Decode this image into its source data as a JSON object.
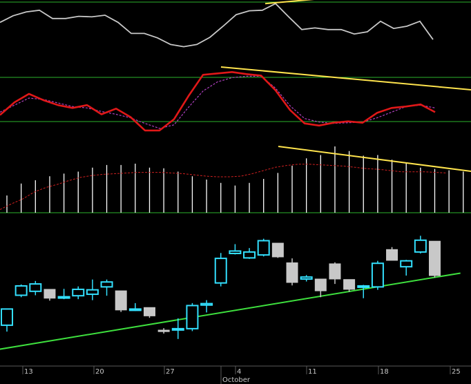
{
  "colors": {
    "background": "#000000",
    "grid": "#2bb52b",
    "trendline": "#ffe44d",
    "support_line": "#3ee03e",
    "oscillator_line": "#c8c8c8",
    "stoch_k": "#e01818",
    "stoch_d": "#b040c0",
    "volume_bar": "#ffffff",
    "volume_ma": "#d02020",
    "candle_up": "#33e0ff",
    "candle_down": "#c8c8c8",
    "axis_text": "#c8c8c8"
  },
  "chart_data": [
    {
      "type": "line",
      "panel": "oscillator",
      "x": [
        0,
        1,
        2,
        3,
        4,
        5,
        6,
        7,
        8,
        9,
        10,
        11,
        12,
        13,
        14,
        15,
        16,
        17,
        18,
        19,
        20,
        21,
        22,
        23,
        24,
        25,
        26,
        27,
        28,
        29,
        30
      ],
      "series": [
        {
          "values": [
            62,
            74,
            81,
            84,
            69,
            69,
            73,
            72,
            75,
            62,
            42,
            42,
            34,
            22,
            18,
            22,
            35,
            55,
            76,
            83,
            84,
            96,
            72,
            49,
            52,
            49,
            49,
            41,
            45,
            64,
            51,
            55,
            64,
            31
          ]
        }
      ],
      "ylim": [
        0,
        100
      ],
      "trendlines": [
        {
          "x": [
            18,
            31.4
          ],
          "y": [
            96,
            64
          ]
        }
      ]
    },
    {
      "type": "line",
      "panel": "stochastic",
      "series": [
        {
          "values": [
            26,
            44,
            56,
            47,
            40,
            36,
            40,
            27,
            35,
            23,
            4,
            4,
            20,
            53,
            83,
            85,
            87,
            84,
            82,
            61,
            33,
            14,
            11,
            15,
            17,
            15,
            29,
            36,
            38,
            41,
            30
          ]
        },
        {
          "values": [
            30,
            40,
            50,
            48,
            43,
            38,
            36,
            31,
            27,
            22,
            14,
            7,
            12,
            37,
            60,
            73,
            79,
            81,
            81,
            64,
            39,
            21,
            16,
            14,
            15,
            16,
            22,
            30,
            38,
            40,
            36
          ]
        }
      ],
      "ylim": [
        0,
        100
      ],
      "levels": [
        80,
        20
      ],
      "trendlines": [
        {
          "x": [
            15,
            32
          ],
          "y": [
            85,
            38
          ]
        }
      ]
    },
    {
      "type": "bar",
      "panel": "volume",
      "values": [
        26,
        44,
        49,
        55,
        59,
        62,
        68,
        72,
        72,
        74,
        68,
        67,
        62,
        55,
        50,
        45,
        41,
        45,
        51,
        60,
        71,
        82,
        87,
        100,
        93,
        86,
        87,
        80,
        75,
        68,
        66,
        64,
        62,
        66,
        57,
        60,
        64,
        70,
        64
      ],
      "moving_average": [
        5,
        14,
        22,
        33,
        40,
        45,
        51,
        56,
        59,
        61,
        62,
        63,
        64,
        64,
        64,
        63,
        62,
        60,
        58,
        57,
        57,
        58,
        62,
        67,
        72,
        75,
        77,
        77,
        76,
        75,
        74,
        72,
        70,
        69,
        67,
        65,
        65,
        65,
        64,
        63
      ],
      "ylim": [
        0,
        100
      ],
      "trendlines": [
        {
          "x": [
            0,
            13.4
          ],
          "y": [
            100,
            65
          ]
        }
      ]
    },
    {
      "type": "candlestick",
      "panel": "price",
      "x_ticks": [
        "13",
        "20",
        "27",
        "4",
        "11",
        "18",
        "25"
      ],
      "x_month_label": "October",
      "candles": [
        {
          "o": 36.2,
          "h": 39.6,
          "l": 34.9,
          "c": 39.5,
          "dir": "up"
        },
        {
          "o": 42.3,
          "h": 44.5,
          "l": 41.9,
          "c": 44.2,
          "dir": "up"
        },
        {
          "o": 43.1,
          "h": 45.2,
          "l": 42.3,
          "c": 44.6,
          "dir": "up"
        },
        {
          "o": 43.5,
          "h": 43.5,
          "l": 41.2,
          "c": 41.7,
          "dir": "down"
        },
        {
          "o": 42.0,
          "h": 43.6,
          "l": 41.5,
          "c": 42.0,
          "dir": "up"
        },
        {
          "o": 42.2,
          "h": 44.1,
          "l": 41.5,
          "c": 43.5,
          "dir": "up"
        },
        {
          "o": 42.5,
          "h": 45.5,
          "l": 41.3,
          "c": 43.4,
          "dir": "up"
        },
        {
          "o": 44.0,
          "h": 45.5,
          "l": 42.2,
          "c": 45.0,
          "dir": "up"
        },
        {
          "o": 43.2,
          "h": 43.2,
          "l": 38.9,
          "c": 39.3,
          "dir": "down"
        },
        {
          "o": 39.5,
          "h": 40.7,
          "l": 39.1,
          "c": 39.5,
          "dir": "up"
        },
        {
          "o": 39.8,
          "h": 39.8,
          "l": 37.7,
          "c": 38.1,
          "dir": "down"
        },
        {
          "o": 35.2,
          "h": 35.6,
          "l": 34.5,
          "c": 34.9,
          "dir": "down"
        },
        {
          "o": 35.5,
          "h": 37.6,
          "l": 33.4,
          "c": 35.5,
          "dir": "up"
        },
        {
          "o": 35.5,
          "h": 40.7,
          "l": 35.0,
          "c": 40.2,
          "dir": "up"
        },
        {
          "o": 40.3,
          "h": 41.3,
          "l": 38.8,
          "c": 40.6,
          "dir": "up"
        },
        {
          "o": 44.8,
          "h": 50.9,
          "l": 44.1,
          "c": 49.8,
          "dir": "up"
        },
        {
          "o": 50.8,
          "h": 52.7,
          "l": 50.6,
          "c": 51.3,
          "dir": "up"
        },
        {
          "o": 49.9,
          "h": 51.9,
          "l": 49.7,
          "c": 51.1,
          "dir": "up"
        },
        {
          "o": 50.5,
          "h": 53.8,
          "l": 50.2,
          "c": 53.4,
          "dir": "up"
        },
        {
          "o": 52.9,
          "h": 52.9,
          "l": 49.9,
          "c": 50.1,
          "dir": "down"
        },
        {
          "o": 48.9,
          "h": 49.8,
          "l": 44.3,
          "c": 44.9,
          "dir": "down"
        },
        {
          "o": 45.6,
          "h": 46.4,
          "l": 45.1,
          "c": 46.0,
          "dir": "up"
        },
        {
          "o": 45.6,
          "h": 45.6,
          "l": 41.9,
          "c": 43.2,
          "dir": "down"
        },
        {
          "o": 48.7,
          "h": 49.0,
          "l": 44.6,
          "c": 45.6,
          "dir": "down"
        },
        {
          "o": 45.5,
          "h": 45.5,
          "l": 43.0,
          "c": 43.5,
          "dir": "down"
        },
        {
          "o": 44.2,
          "h": 44.4,
          "l": 41.7,
          "c": 44.2,
          "dir": "up"
        },
        {
          "o": 44.0,
          "h": 49.3,
          "l": 43.4,
          "c": 48.8,
          "dir": "up"
        },
        {
          "o": 49.4,
          "h": 52.1,
          "l": 49.4,
          "c": 51.6,
          "dir": "down"
        },
        {
          "o": 48.1,
          "h": 49.5,
          "l": 46.3,
          "c": 49.3,
          "dir": "up"
        },
        {
          "o": 51.1,
          "h": 54.4,
          "l": 50.8,
          "c": 53.5,
          "dir": "up"
        },
        {
          "o": 53.3,
          "h": 53.3,
          "l": 45.9,
          "c": 46.3,
          "dir": "down"
        }
      ],
      "support_line": {
        "from": [
          -2,
          30.6
        ],
        "to": [
          31.8,
          46.8
        ]
      }
    }
  ]
}
